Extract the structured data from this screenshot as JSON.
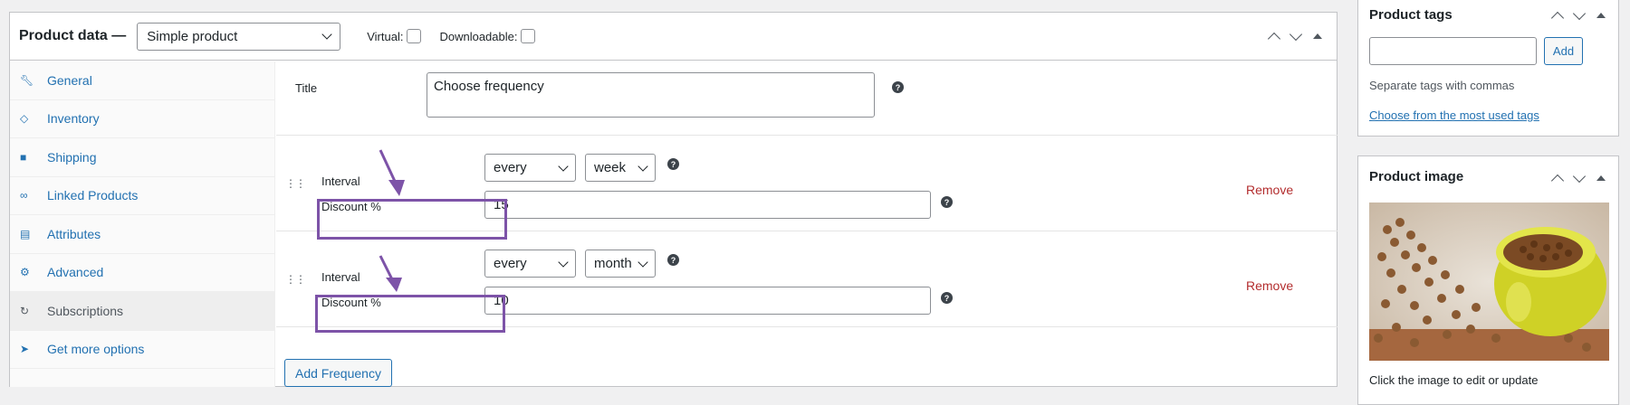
{
  "product_data": {
    "title": "Product data —",
    "type_value": "Simple product",
    "virtual_label": "Virtual:",
    "downloadable_label": "Downloadable:"
  },
  "tabs": [
    {
      "label": "General",
      "icon": "wrench-icon"
    },
    {
      "label": "Inventory",
      "icon": "tag-icon"
    },
    {
      "label": "Shipping",
      "icon": "truck-icon"
    },
    {
      "label": "Linked Products",
      "icon": "link-icon"
    },
    {
      "label": "Attributes",
      "icon": "list-icon"
    },
    {
      "label": "Advanced",
      "icon": "gear-icon"
    },
    {
      "label": "Subscriptions",
      "icon": "cycle-icon",
      "active": true
    },
    {
      "label": "Get more options",
      "icon": "plugin-icon"
    }
  ],
  "subscription": {
    "title_label": "Title",
    "title_value": "Choose frequency",
    "frequencies": [
      {
        "interval_label": "Interval",
        "every": "every",
        "period": "week",
        "discount_label": "Discount %",
        "discount": "15",
        "remove": "Remove"
      },
      {
        "interval_label": "Interval",
        "every": "every",
        "period": "month",
        "discount_label": "Discount %",
        "discount": "10",
        "remove": "Remove"
      }
    ],
    "add_label": "Add Frequency"
  },
  "product_tags": {
    "title": "Product tags",
    "add_label": "Add",
    "hint": "Separate tags with commas",
    "link": "Choose from the most used tags"
  },
  "product_image": {
    "title": "Product image",
    "hint": "Click the image to edit or update"
  },
  "colors": {
    "accent": "#2271b1",
    "remove": "#b32d2e",
    "highlight": "#7d53a8"
  }
}
